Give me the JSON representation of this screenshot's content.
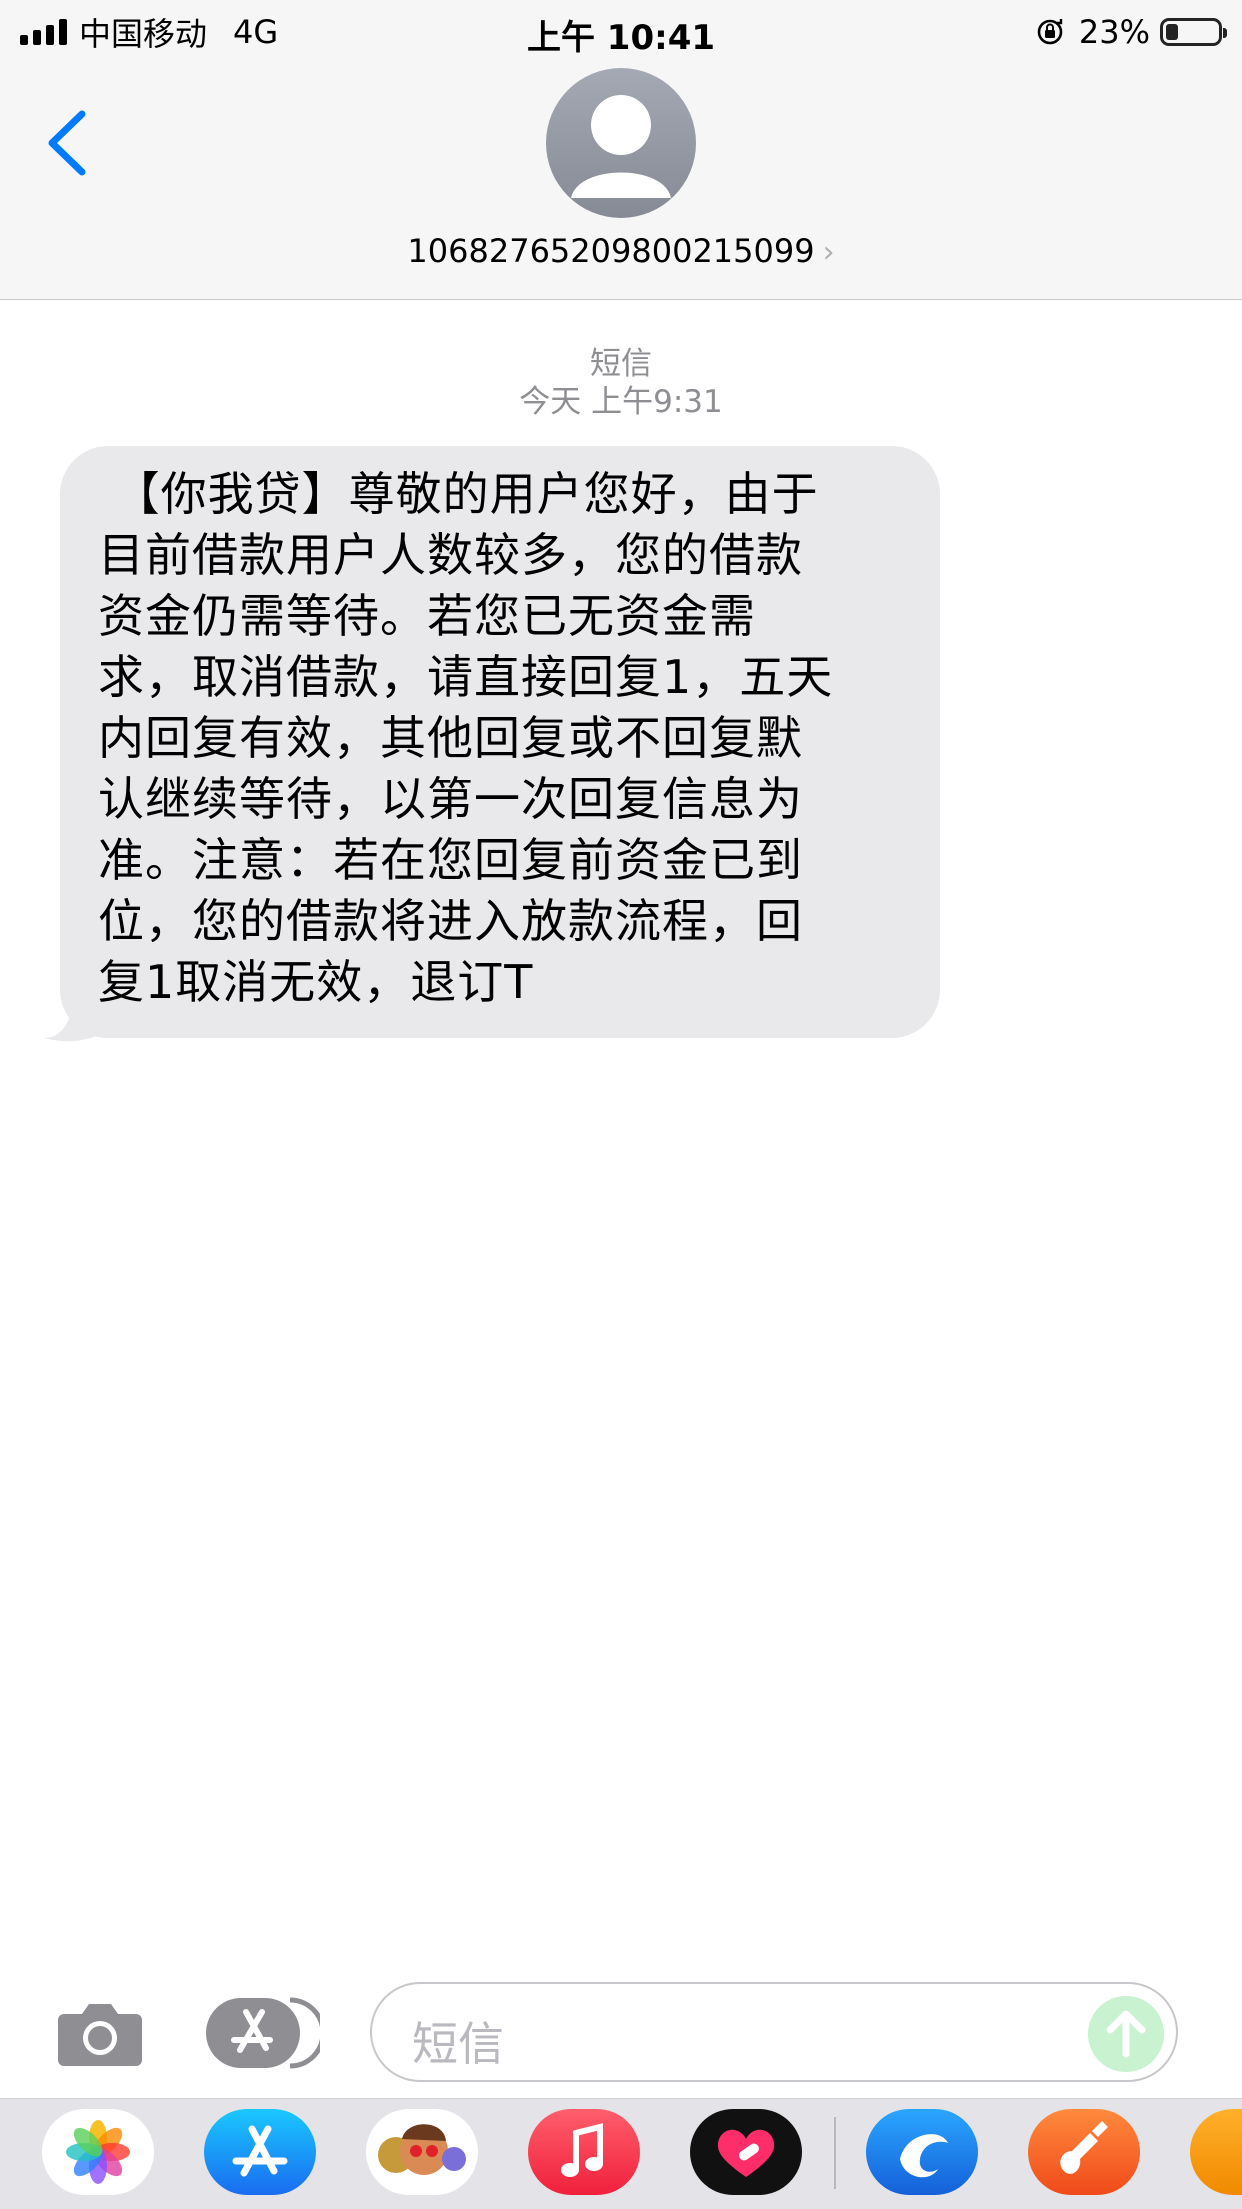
{
  "status_bar": {
    "carrier": "中国移动",
    "network": "4G",
    "time": "上午 10:41",
    "battery_percent": "23%",
    "battery_level": 0.23
  },
  "nav": {
    "contact_number": "10682765209800215099",
    "back_icon": "chevron-left-icon",
    "avatar_icon": "person-silhouette-icon"
  },
  "conversation": {
    "label": "短信",
    "timestamp": "今天 上午9:31",
    "message_text": " 【你我贷】尊敬的用户您好，由于\n目前借款用户人数较多，您的借款\n资金仍需等待。若您已无资金需\n求，取消借款，请直接回复1，五天\n内回复有效，其他回复或不回复默\n认继续等待，以第一次回复信息为\n准。注意：若在您回复前资金已到\n位，您的借款将进入放款流程，回\n复1取消无效，退订T"
  },
  "input_bar": {
    "placeholder": "短信",
    "camera_icon": "camera-icon",
    "apps_icon": "app-store-icon",
    "send_icon": "send-arrow-up-icon"
  },
  "app_drawer": {
    "apps": [
      "photos-icon",
      "app-store-icon",
      "memoji-icon",
      "music-icon",
      "heart-digital-touch-icon",
      "dolphin-app-icon",
      "garageband-icon",
      "partial-app-icon"
    ]
  },
  "colors": {
    "accent": "#007aff",
    "bubble_gray": "#e9e9eb",
    "header_bg": "#f6f6f6",
    "send_disabled": "#c9f2d1"
  }
}
